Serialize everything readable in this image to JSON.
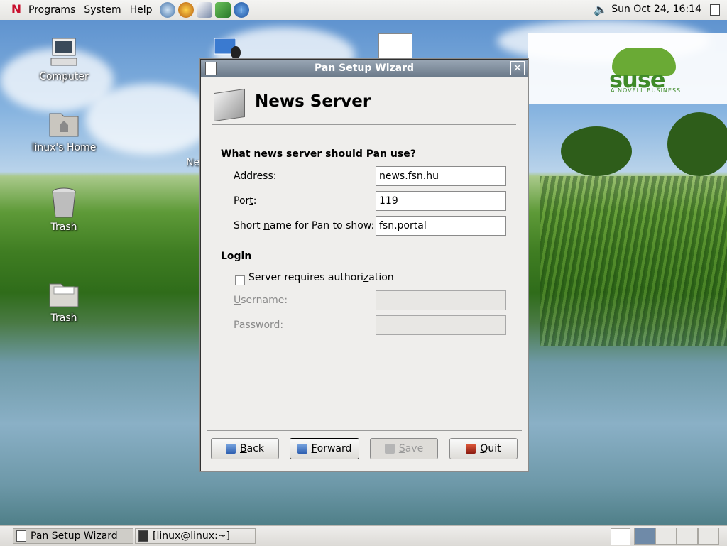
{
  "panel": {
    "menus": [
      "Programs",
      "System",
      "Help"
    ],
    "launchers": [
      "browser-icon",
      "firefox-icon",
      "editor-icon",
      "network-icon",
      "update-icon"
    ],
    "clock": "Sun Oct 24, 16:14",
    "volume_icon": "speaker-icon",
    "show_desktop_icon": "show-desktop-icon"
  },
  "desktop": {
    "icons": [
      {
        "label": "Computer",
        "icon": "computer-icon"
      },
      {
        "label": "linux's Home",
        "icon": "home-folder-icon"
      },
      {
        "label": "Trash",
        "icon": "trash-icon"
      },
      {
        "label": "Trash",
        "icon": "folder-icon"
      }
    ],
    "partial_label": "Ne"
  },
  "branding": {
    "word": "suse",
    "tagline": "A NOVELL BUSINESS"
  },
  "dialog": {
    "title": "Pan Setup Wizard",
    "page_title": "News Server",
    "server_section": "What news server should Pan use?",
    "address_label_prefix": "",
    "address_label_ul": "A",
    "address_label_rest": "ddress:",
    "address_value": "news.fsn.hu",
    "port_label_prefix": "Por",
    "port_label_ul": "t",
    "port_label_rest": ":",
    "port_value": "119",
    "shortname_label_prefix": "Short ",
    "shortname_label_ul": "n",
    "shortname_label_rest": "ame for Pan to show:",
    "shortname_value": "fsn.portal",
    "login_section": "Login",
    "auth_label_prefix": "Server requires authori",
    "auth_label_ul": "z",
    "auth_label_rest": "ation",
    "auth_checked": false,
    "username_label_ul": "U",
    "username_label_rest": "sername:",
    "username_value": "",
    "password_label_ul": "P",
    "password_label_rest": "assword:",
    "password_value": "",
    "buttons": {
      "back_ul": "B",
      "back_rest": "ack",
      "forward_ul": "F",
      "forward_rest": "orward",
      "save_ul": "S",
      "save_rest": "ave",
      "quit_ul": "Q",
      "quit_rest": "uit"
    }
  },
  "taskbar": {
    "tasks": [
      "Pan Setup Wizard",
      "[linux@linux:~]"
    ],
    "workspaces": 4,
    "active_workspace": 1
  }
}
